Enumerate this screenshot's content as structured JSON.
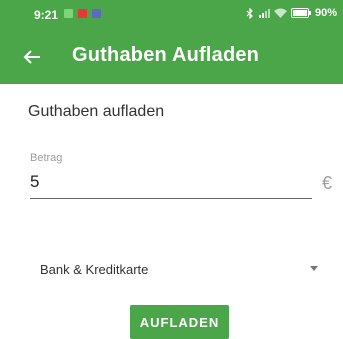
{
  "status_bar": {
    "time": "9:21",
    "battery": "90%"
  },
  "app_bar": {
    "title": "Guthaben Aufladen",
    "back_icon": "arrow-left-icon"
  },
  "form": {
    "heading": "Guthaben aufladen",
    "amount_label": "Betrag",
    "amount_value": "5",
    "currency_symbol": "€",
    "payment_method": "Bank & Kreditkarte",
    "submit_label": "AUFLADEN"
  },
  "colors": {
    "primary": "#4ba649",
    "text": "#333333",
    "hint": "#9e9e9e"
  }
}
